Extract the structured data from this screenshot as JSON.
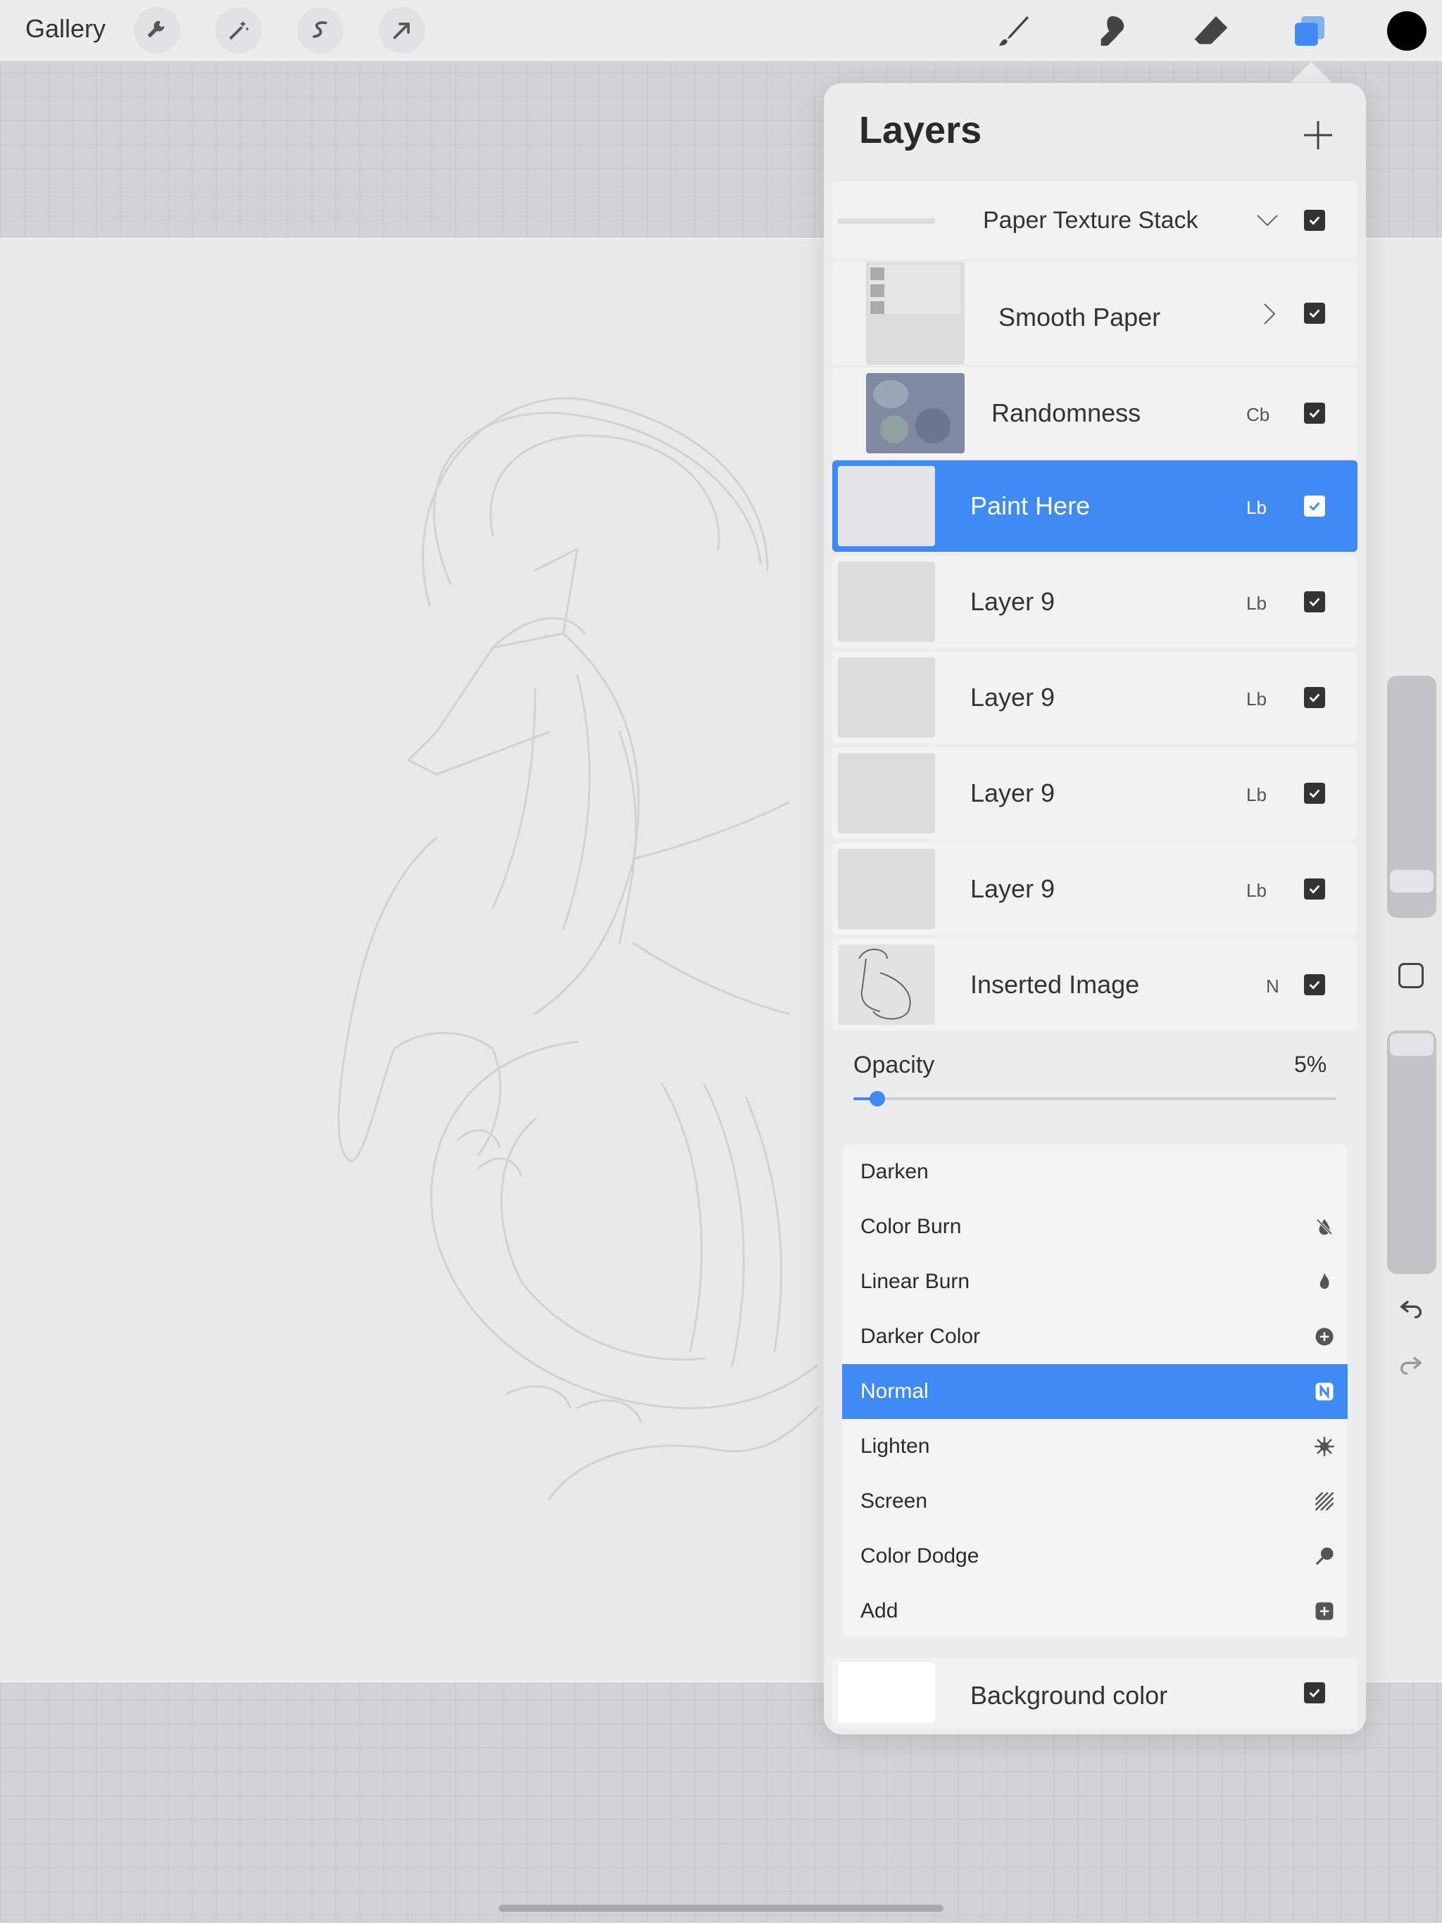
{
  "topbar": {
    "gallery_label": "Gallery",
    "left_tools": [
      "wrench-icon",
      "magic-wand-icon",
      "selection-s-icon",
      "transform-arrow-icon"
    ],
    "right_tools": [
      "brush-icon",
      "smudge-icon",
      "eraser-icon",
      "layers-icon"
    ],
    "color": "#000000",
    "accent": "#3f8af4"
  },
  "panel": {
    "title": "Layers",
    "group": {
      "name": "Paper Texture Stack"
    },
    "layers": [
      {
        "name": "Smooth Paper",
        "mode": "",
        "selected": false
      },
      {
        "name": "Randomness",
        "mode": "Cb",
        "selected": false
      },
      {
        "name": "Paint Here",
        "mode": "Lb",
        "selected": true
      },
      {
        "name": "Layer 9",
        "mode": "Lb",
        "selected": false
      },
      {
        "name": "Layer 9",
        "mode": "Lb",
        "selected": false
      },
      {
        "name": "Layer 9",
        "mode": "Lb",
        "selected": false
      },
      {
        "name": "Layer 9",
        "mode": "Lb",
        "selected": false
      },
      {
        "name": "Inserted Image",
        "mode": "N",
        "selected": false
      }
    ],
    "opacity_label": "Opacity",
    "opacity_value": "5%",
    "opacity_fraction": 0.05,
    "blend_modes": [
      {
        "label": "Darken",
        "icon": "moon-icon"
      },
      {
        "label": "Color Burn",
        "icon": "drop-slash-icon"
      },
      {
        "label": "Linear Burn",
        "icon": "flame-icon"
      },
      {
        "label": "Darker Color",
        "icon": "plus-circle-icon"
      },
      {
        "label": "Normal",
        "icon": "n-badge-icon",
        "selected": true
      },
      {
        "label": "Lighten",
        "icon": "sun-burst-icon"
      },
      {
        "label": "Screen",
        "icon": "hatch-icon"
      },
      {
        "label": "Color Dodge",
        "icon": "dodge-icon"
      },
      {
        "label": "Add",
        "icon": "plus-square-icon"
      }
    ],
    "background_label": "Background color"
  }
}
